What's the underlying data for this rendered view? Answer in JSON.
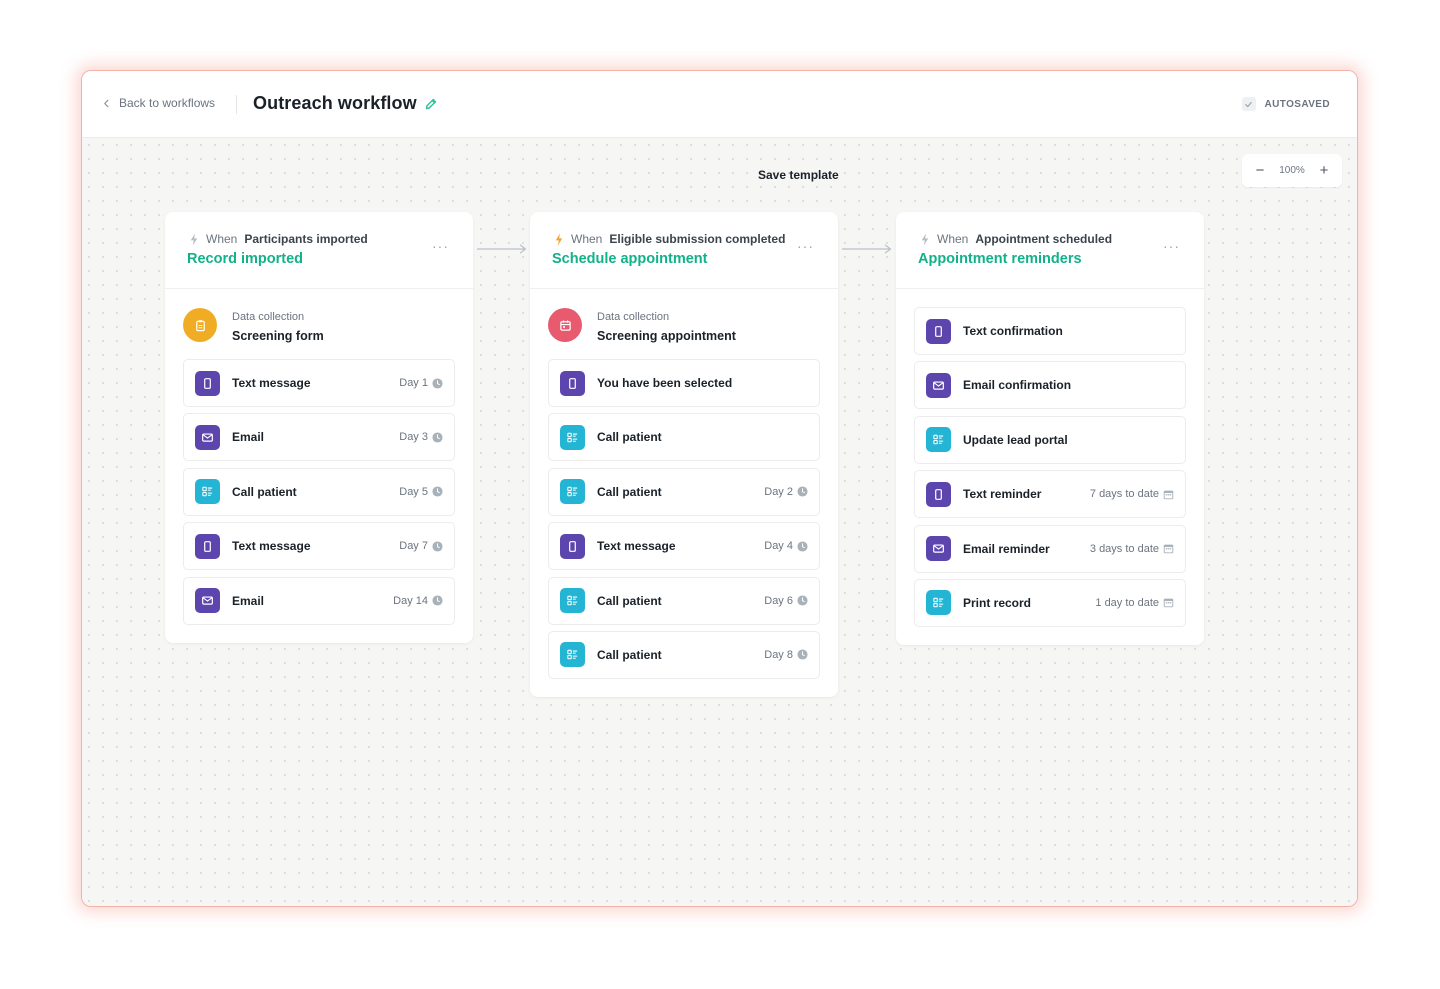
{
  "header": {
    "back_label": "Back to workflows",
    "title": "Outreach workflow",
    "status": "AUTOSAVED"
  },
  "toolbar": {
    "save_template": "Save template",
    "zoom_minus": "−",
    "zoom_value": "100%",
    "zoom_plus": "+"
  },
  "columns": [
    {
      "trigger_prefix": "When",
      "trigger_event": "Participants imported",
      "title": "Record imported",
      "more": "···",
      "collection": {
        "subtitle": "Data collection",
        "name": "Screening form",
        "color": "#f0ad24",
        "icon": "clipboard-icon"
      },
      "items": [
        {
          "label": "Text message",
          "meta": "Day 1",
          "icon": "phone-icon",
          "color": "#5c45ad"
        },
        {
          "label": "Email",
          "meta": "Day 3",
          "icon": "mail-icon",
          "color": "#5c45ad"
        },
        {
          "label": "Call patient",
          "meta": "Day 5",
          "icon": "list-icon",
          "color": "#25b5d4"
        },
        {
          "label": "Text message",
          "meta": "Day 7",
          "icon": "phone-icon",
          "color": "#5c45ad"
        },
        {
          "label": "Email",
          "meta": "Day 14",
          "icon": "mail-icon",
          "color": "#5c45ad"
        }
      ]
    },
    {
      "trigger_prefix": "When",
      "trigger_event": "Eligible submission completed",
      "title": "Schedule appointment",
      "more": "···",
      "collection": {
        "subtitle": "Data collection",
        "name": "Screening appointment",
        "color": "#e85a6e",
        "icon": "calendar-icon"
      },
      "items": [
        {
          "label": "You have been selected",
          "meta": "",
          "icon": "phone-icon",
          "color": "#5c45ad"
        },
        {
          "label": "Call patient",
          "meta": "",
          "icon": "list-icon",
          "color": "#25b5d4"
        },
        {
          "label": "Call patient",
          "meta": "Day 2",
          "icon": "list-icon",
          "color": "#25b5d4"
        },
        {
          "label": "Text message",
          "meta": "Day 4",
          "icon": "phone-icon",
          "color": "#5c45ad"
        },
        {
          "label": "Call patient",
          "meta": "Day 6",
          "icon": "list-icon",
          "color": "#25b5d4"
        },
        {
          "label": "Call patient",
          "meta": "Day 8",
          "icon": "list-icon",
          "color": "#25b5d4"
        }
      ]
    },
    {
      "trigger_prefix": "When",
      "trigger_event": "Appointment scheduled",
      "title": "Appointment reminders",
      "more": "···",
      "items": [
        {
          "label": "Text confirmation",
          "meta": "",
          "icon": "phone-icon",
          "color": "#5c45ad"
        },
        {
          "label": "Email confirmation",
          "meta": "",
          "icon": "mail-icon",
          "color": "#5c45ad"
        },
        {
          "label": "Update lead portal",
          "meta": "",
          "icon": "list-icon",
          "color": "#25b5d4"
        },
        {
          "label": "Text reminder",
          "meta": "7 days to date",
          "icon": "phone-icon",
          "color": "#5c45ad",
          "meta_icon": "calendar-small-icon"
        },
        {
          "label": "Email reminder",
          "meta": "3 days to date",
          "icon": "mail-icon",
          "color": "#5c45ad",
          "meta_icon": "calendar-small-icon"
        },
        {
          "label": "Print record",
          "meta": "1 day to date",
          "icon": "list-icon",
          "color": "#25b5d4",
          "meta_icon": "calendar-small-icon"
        }
      ]
    }
  ],
  "colors": {
    "accent": "#11b28a",
    "purple": "#5c45ad",
    "teal": "#25b5d4",
    "window_glow": "#f27662"
  }
}
